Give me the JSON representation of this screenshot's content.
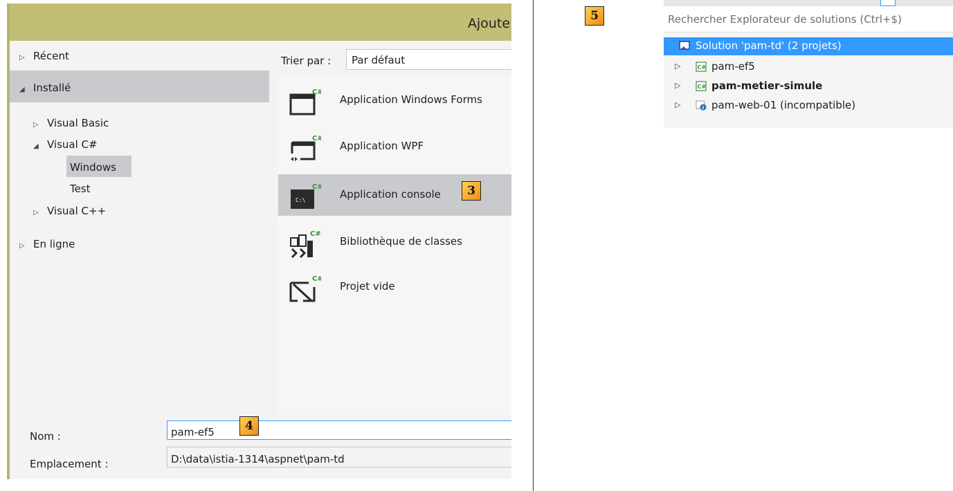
{
  "dialog": {
    "title": "Ajoute",
    "nav": {
      "recent": "Récent",
      "installed": "Installé",
      "visual_basic": "Visual Basic",
      "visual_csharp": "Visual C#",
      "windows": "Windows",
      "test": "Test",
      "visual_cpp": "Visual C++",
      "online": "En ligne"
    },
    "sort": {
      "label": "Trier par :",
      "value": "Par défaut"
    },
    "templates": [
      {
        "label": "Application Windows Forms",
        "icon": "windows-forms-icon"
      },
      {
        "label": "Application WPF",
        "icon": "wpf-icon"
      },
      {
        "label": "Application console",
        "icon": "console-icon",
        "selected": true
      },
      {
        "label": "Bibliothèque de classes",
        "icon": "class-library-icon"
      },
      {
        "label": "Projet vide",
        "icon": "empty-project-icon"
      }
    ],
    "name_label": "Nom :",
    "name_value": "pam-ef5",
    "location_label": "Emplacement :",
    "location_value": "D:\\data\\istia-1314\\aspnet\\pam-td"
  },
  "callouts": {
    "c3": "3",
    "c4": "4",
    "c5": "5"
  },
  "explorer": {
    "search_placeholder": "Rechercher Explorateur de solutions (Ctrl+$)",
    "solution": "Solution 'pam-td' (2 projets)",
    "projects": [
      {
        "label": "pam-ef5",
        "bold": false
      },
      {
        "label": "pam-metier-simule",
        "bold": true
      },
      {
        "label": "pam-web-01 (incompatible)",
        "bold": false
      }
    ]
  },
  "colors": {
    "accent": "#3399ff",
    "title_bar": "#c3be75",
    "selection": "#c9cacd",
    "callout": "#f5a623"
  }
}
